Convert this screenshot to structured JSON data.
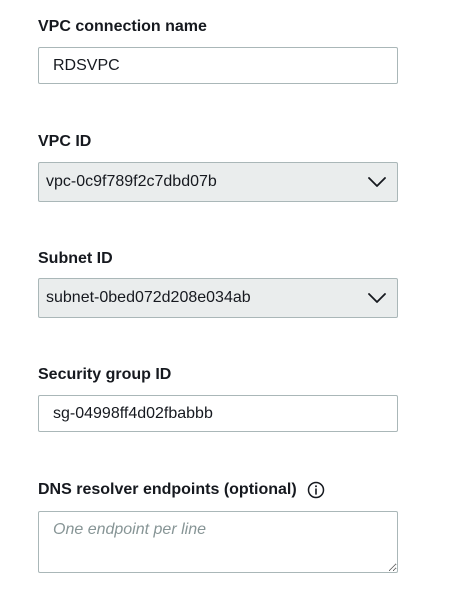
{
  "vpc_connection": {
    "label": "VPC connection name",
    "value": "RDSVPC"
  },
  "vpc_id": {
    "label": "VPC ID",
    "selected": "vpc-0c9f789f2c7dbd07b"
  },
  "subnet_id": {
    "label": "Subnet ID",
    "selected": "subnet-0bed072d208e034ab"
  },
  "security_group": {
    "label": "Security group ID",
    "value": "sg-04998ff4d02fbabbb"
  },
  "dns_resolver": {
    "label": "DNS resolver endpoints (optional)",
    "placeholder": "One endpoint per line",
    "info_icon": "info-icon"
  },
  "icons": {
    "dropdown": "chevron-down-icon",
    "resize": "resize-handle-icon"
  }
}
